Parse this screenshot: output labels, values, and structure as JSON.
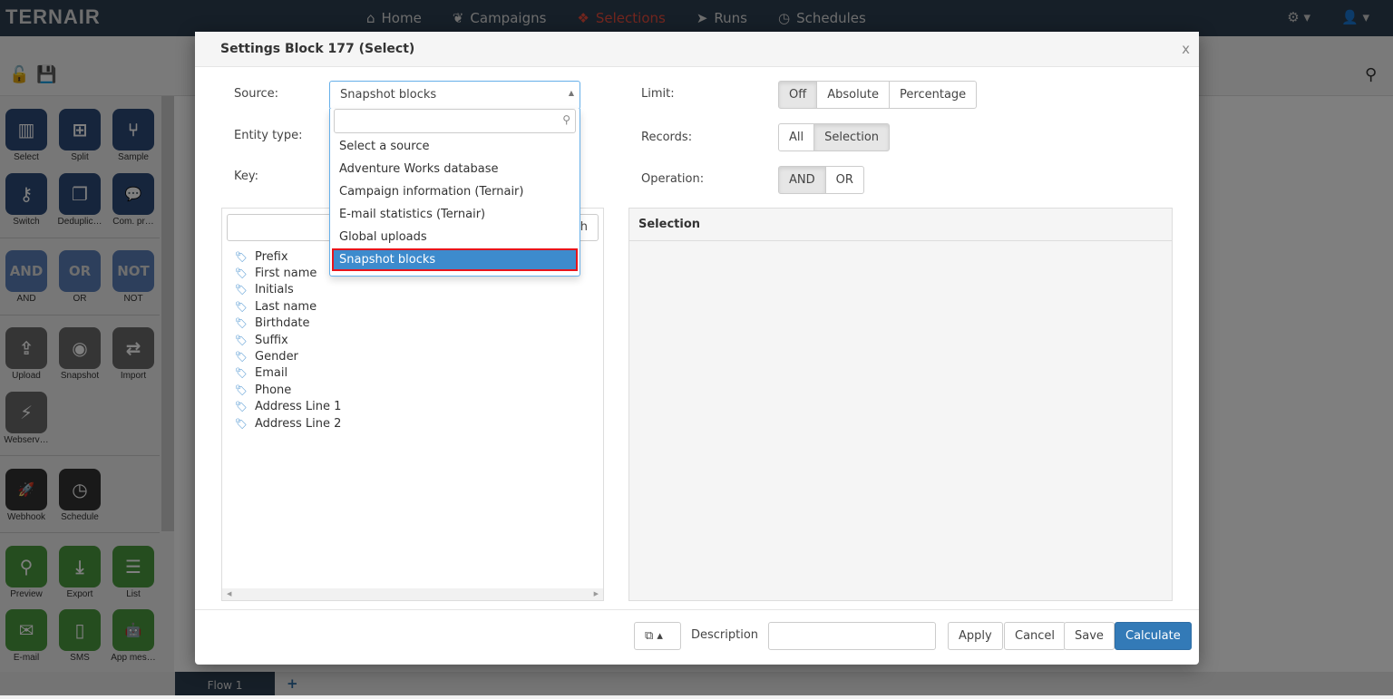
{
  "app": {
    "logo": "TERNAIR"
  },
  "nav": {
    "items": [
      {
        "label": "Home",
        "icon": "home"
      },
      {
        "label": "Campaigns",
        "icon": "leaf"
      },
      {
        "label": "Selections",
        "icon": "cubes"
      },
      {
        "label": "Runs",
        "icon": "paper-plane"
      },
      {
        "label": "Schedules",
        "icon": "clock"
      }
    ],
    "active": "Selections"
  },
  "sidebar": {
    "tiles": [
      {
        "label": "Select",
        "icon": "▥"
      },
      {
        "label": "Split",
        "icon": "⊞"
      },
      {
        "label": "Sample",
        "icon": "⑂"
      },
      {
        "label": "Switch",
        "icon": "⚷"
      },
      {
        "label": "Deduplic…",
        "icon": "❐"
      },
      {
        "label": "Com. pr…",
        "icon": "💬"
      },
      {
        "label": "AND",
        "icon": "AND"
      },
      {
        "label": "OR",
        "icon": "OR"
      },
      {
        "label": "NOT",
        "icon": "NOT"
      },
      {
        "label": "Upload",
        "icon": "⇪"
      },
      {
        "label": "Snapshot",
        "icon": "◉"
      },
      {
        "label": "Import",
        "icon": "⇄"
      },
      {
        "label": "Webserv…",
        "icon": "⚡"
      },
      {
        "label": "Webhook",
        "icon": "🚀"
      },
      {
        "label": "Schedule",
        "icon": "◷"
      },
      {
        "label": "Preview",
        "icon": "⚲"
      },
      {
        "label": "Export",
        "icon": "⤓"
      },
      {
        "label": "List",
        "icon": "☰"
      },
      {
        "label": "E-mail",
        "icon": "✉"
      },
      {
        "label": "SMS",
        "icon": "▯"
      },
      {
        "label": "App mes…",
        "icon": "🤖"
      }
    ]
  },
  "tabs": {
    "flow": "Flow 1",
    "add": "+"
  },
  "modal": {
    "title": "Settings Block 177 (Select)",
    "close": "x",
    "source_label": "Source:",
    "source_value": "Snapshot blocks",
    "entity_label": "Entity type:",
    "key_label": "Key:",
    "source_options": [
      "Select a source",
      "Adventure Works database",
      "Campaign information (Ternair)",
      "E-mail statistics (Ternair)",
      "Global uploads",
      "Snapshot blocks"
    ],
    "search_button_partial": "h",
    "fields": [
      "Prefix",
      "First name",
      "Initials",
      "Last name",
      "Birthdate",
      "Suffix",
      "Gender",
      "Email",
      "Phone",
      "Address Line 1",
      "Address Line 2"
    ],
    "limit_label": "Limit:",
    "limit_options": [
      "Off",
      "Absolute",
      "Percentage"
    ],
    "limit_selected": "Off",
    "records_label": "Records:",
    "records_options": [
      "All",
      "Selection"
    ],
    "records_selected": "Selection",
    "operation_label": "Operation:",
    "operation_options": [
      "AND",
      "OR"
    ],
    "operation_selected": "AND",
    "selection_header": "Selection",
    "footer": {
      "description_label": "Description",
      "description_value": "",
      "apply": "Apply",
      "cancel": "Cancel",
      "save": "Save",
      "calculate": "Calculate"
    }
  },
  "colors": {
    "nav": "#2c3e50",
    "active": "#e74c3c",
    "primary": "#337ab7",
    "highlight": "#3d8bcd"
  }
}
